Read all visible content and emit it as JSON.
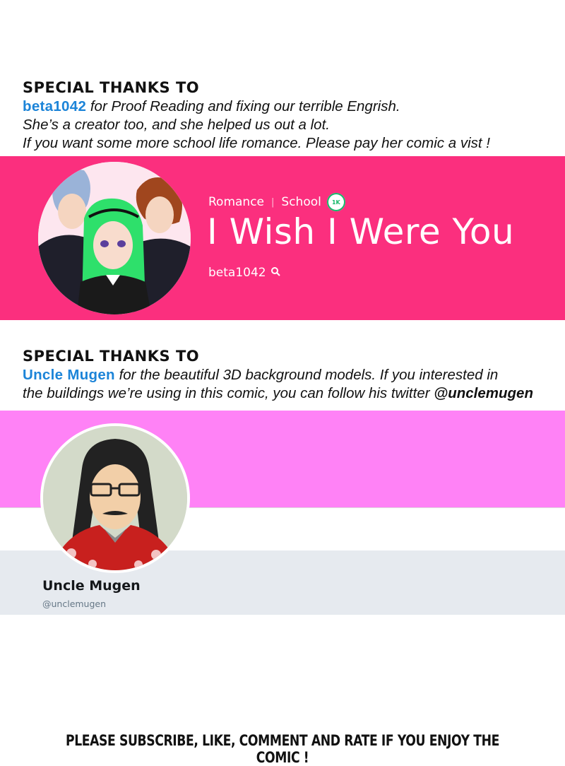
{
  "section1": {
    "heading": "SPECIAL THANKS TO",
    "name": "beta1042",
    "line1_rest": " for Proof Reading and fixing our terrible Engrish.",
    "line2": "She’s a creator too, and she helped us out a lot.",
    "line3": "If you want some more school life romance. Please pay her comic a vist !"
  },
  "webtoon": {
    "genre1": "Romance",
    "genre2": "School",
    "badge": "1K",
    "title": "I Wish I Were You",
    "author": "beta1042",
    "search_icon": "search-icon",
    "banner_color": "#fb2f7e"
  },
  "section2": {
    "heading": "SPECIAL THANKS TO",
    "name": "Uncle Mugen",
    "line1_rest": " for the beautiful 3D background models. If you interested in",
    "line2": "the buildings we’re using in this comic, you can follow his twitter ",
    "handle": "@unclemugen"
  },
  "twitter": {
    "name": "Uncle Mugen",
    "handle": "@unclemugen",
    "header_color": "#ff82f6"
  },
  "footer": {
    "text": "PLEASE SUBSCRIBE, LIKE, COMMENT AND RATE IF YOU ENJOY THE COMIC !"
  }
}
